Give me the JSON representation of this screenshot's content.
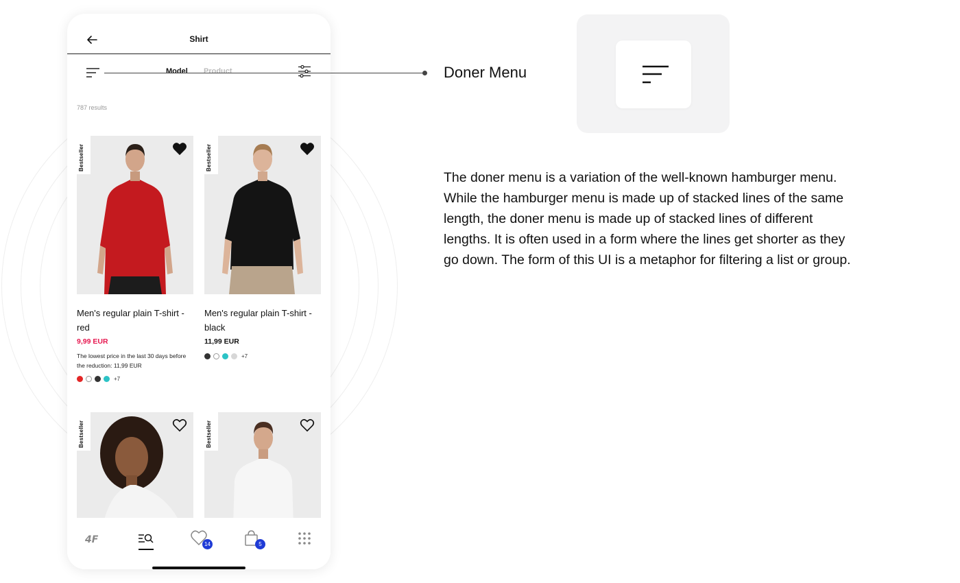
{
  "header": {
    "title": "Shirt"
  },
  "filters": {
    "tab_model": "Model",
    "tab_product": "Product"
  },
  "results_text": "787 results",
  "products": [
    {
      "badge": "Bestseller",
      "name": "Men's regular plain T-shirt - red",
      "price": "9,99 EUR",
      "price_color": "#e6174f",
      "note": "The lowest price in the last 30 days before the reduction: 11,99 EUR",
      "more_colors": "+7",
      "favorite": true,
      "swatches": [
        "#e32626",
        "#ffffff",
        "#333333",
        "#2cc3c6"
      ]
    },
    {
      "badge": "Bestseller",
      "name": "Men's regular plain T-shirt - black",
      "price": "11,99 EUR",
      "price_color": "#111111",
      "more_colors": "+7",
      "favorite": true,
      "swatches": [
        "#333333",
        "#ffffff",
        "#2cc3c6",
        "#d7d7d7"
      ]
    },
    {
      "badge": "Bestseller",
      "favorite": false
    },
    {
      "badge": "Bestseller",
      "favorite": false
    }
  ],
  "tabbar": {
    "items": [
      "home-logo-icon",
      "search-list-icon",
      "heart-icon",
      "bag-icon",
      "grid-menu-icon"
    ],
    "favorites_count": "14",
    "cart_count": "5"
  },
  "callout": {
    "title": "Doner Menu",
    "description": "The doner menu is a variation of the well-known hamburger menu. While the hamburger menu is made up of stacked lines of the same length, the doner menu is made up of stacked lines of different lengths. It is often used in a form where the lines get shorter as they go down. The form of this UI is a metaphor for filtering a list or group."
  }
}
